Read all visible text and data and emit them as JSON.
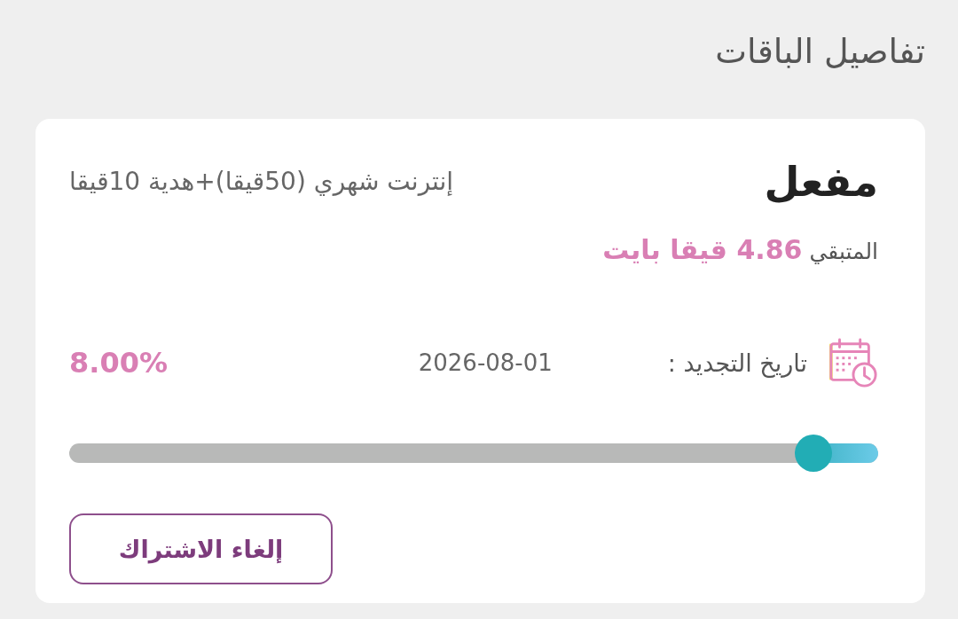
{
  "section_title": "تفاصيل الباقات",
  "package": {
    "status": "مفعل",
    "name": "إنترنت شهري (50قيقا)+هدية 10قيقا",
    "remaining": "المتبقي **4.86 قيقا بايت**",
    "renewal_label": "تاريخ التجديد :",
    "renewal_date": "2026-08-01",
    "usage_percent": "8.00%",
    "usage": {
      "level": 0.08
    },
    "cancel_button": "إلغاء الاشتراك"
  }
}
